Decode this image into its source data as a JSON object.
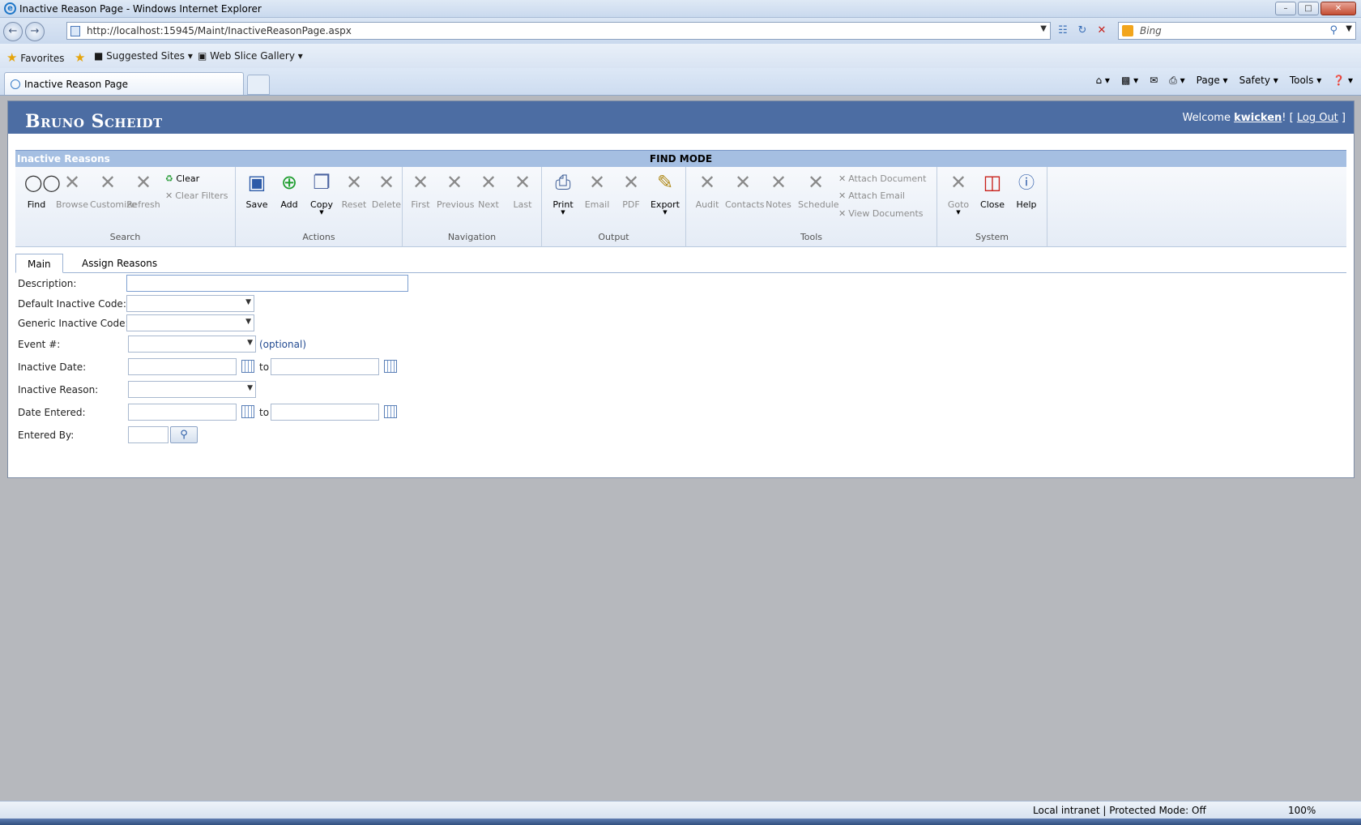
{
  "window": {
    "title": "Inactive Reason Page - Windows Internet Explorer"
  },
  "address": {
    "url": "http://localhost:15945/Maint/InactiveReasonPage.aspx"
  },
  "search": {
    "placeholder": "Bing"
  },
  "favorites": {
    "label": "Favorites",
    "suggested": "Suggested Sites",
    "webslice": "Web Slice Gallery"
  },
  "tab": {
    "label": "Inactive Reason Page"
  },
  "commands": {
    "page": "Page",
    "safety": "Safety",
    "tools": "Tools"
  },
  "app": {
    "brand": "Bruno Scheidt",
    "welcome_prefix": "Welcome ",
    "user": "kwicken",
    "logout": "Log Out",
    "title": "Inactive Reasons",
    "mode": "FIND MODE"
  },
  "ribbon": {
    "groups": {
      "search": "Search",
      "actions": "Actions",
      "navigation": "Navigation",
      "output": "Output",
      "tools": "Tools",
      "system": "System"
    },
    "find": "Find",
    "browse": "Browse",
    "customize": "Customize",
    "refresh": "Refresh",
    "clear": "Clear",
    "clear_filters": "Clear Filters",
    "save": "Save",
    "add": "Add",
    "copy": "Copy",
    "reset": "Reset",
    "delete": "Delete",
    "first": "First",
    "previous": "Previous",
    "next": "Next",
    "last": "Last",
    "print": "Print",
    "email": "Email",
    "pdf": "PDF",
    "export": "Export",
    "audit": "Audit",
    "contacts": "Contacts",
    "notes": "Notes",
    "schedule": "Schedule",
    "attach_document": "Attach Document",
    "attach_email": "Attach Email",
    "view_documents": "View Documents",
    "goto": "Goto",
    "close": "Close",
    "help": "Help"
  },
  "tabs": {
    "main": "Main",
    "assign": "Assign Reasons"
  },
  "form": {
    "description": "Description:",
    "default_code": "Default Inactive Code:",
    "generic_code": "Generic Inactive Code:",
    "event": "Event #:",
    "optional": "(optional)",
    "inactive_date": "Inactive Date:",
    "to": "to",
    "inactive_reason": "Inactive Reason:",
    "date_entered": "Date Entered:",
    "entered_by": "Entered By:"
  },
  "status": {
    "zone": "Local intranet | Protected Mode: Off",
    "zoom": "100%"
  }
}
